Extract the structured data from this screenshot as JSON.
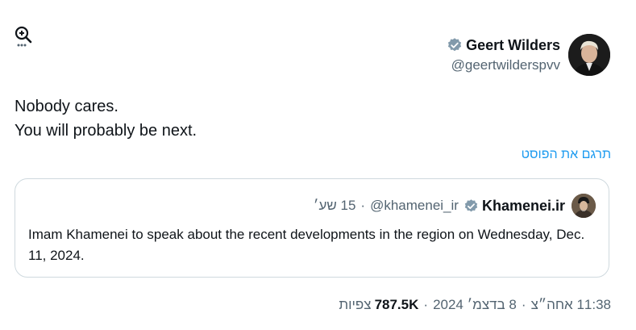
{
  "author": {
    "name": "Geert Wilders",
    "handle": "@geertwilderspvv",
    "verified": true,
    "avatar_icon": "geert-wilders-avatar"
  },
  "tweet": {
    "lines": [
      "Nobody cares.",
      "You will probably be next."
    ],
    "translate_label": "תרגם את הפוסט"
  },
  "quoted": {
    "name": "Khamenei.ir",
    "handle": "@khamenei_ir",
    "time": "15 שע׳",
    "text": "Imam Khamenei to speak about the recent developments in the region on Wednesday, Dec. 11, 2024.",
    "avatar_icon": "khamenei-avatar"
  },
  "meta": {
    "time": "11:38 אחה״צ",
    "date": "8 בדצמ׳ 2024",
    "views_count": "787.5K",
    "views_label": "צפיות"
  },
  "colors": {
    "link": "#1d9bf0",
    "secondary_text": "#536471",
    "verified_badge": "#829aab",
    "border": "#cfd9de"
  }
}
